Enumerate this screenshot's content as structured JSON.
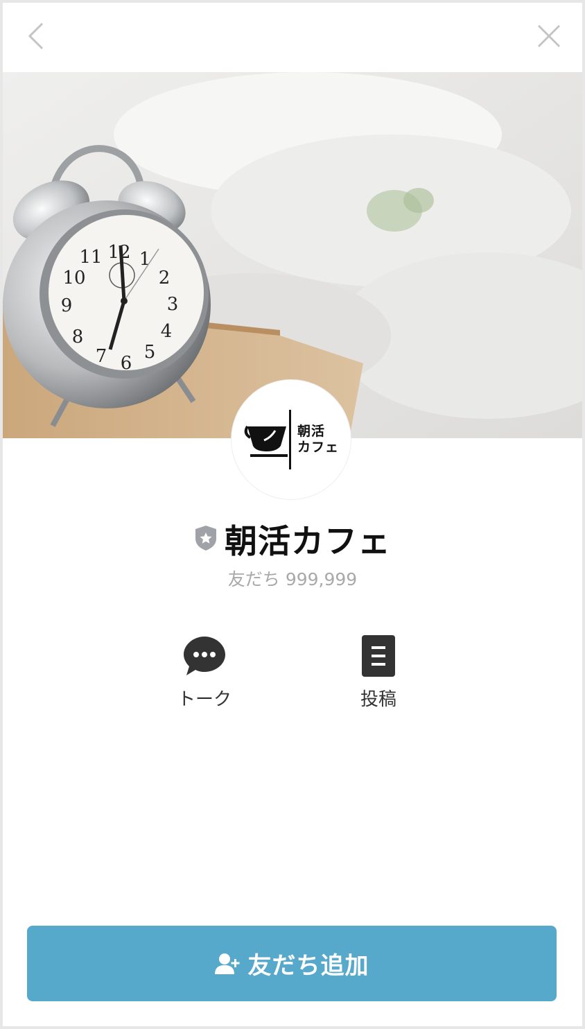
{
  "header": {
    "back_icon": "chevron-left-icon",
    "close_icon": "close-icon"
  },
  "profile": {
    "logo_line1": "朝活",
    "logo_line2": "カフェ",
    "name": "朝活カフェ",
    "badge_icon": "verified-shield-icon",
    "friends_label": "友だち",
    "friends_count": "999,999"
  },
  "actions": [
    {
      "label": "トーク",
      "icon": "chat-bubble-icon"
    },
    {
      "label": "投稿",
      "icon": "document-icon"
    }
  ],
  "add_friend": {
    "label": "友だち追加",
    "icon": "add-user-icon"
  },
  "colors": {
    "button": "#56a9cb",
    "badge": "#9fa3a7"
  }
}
